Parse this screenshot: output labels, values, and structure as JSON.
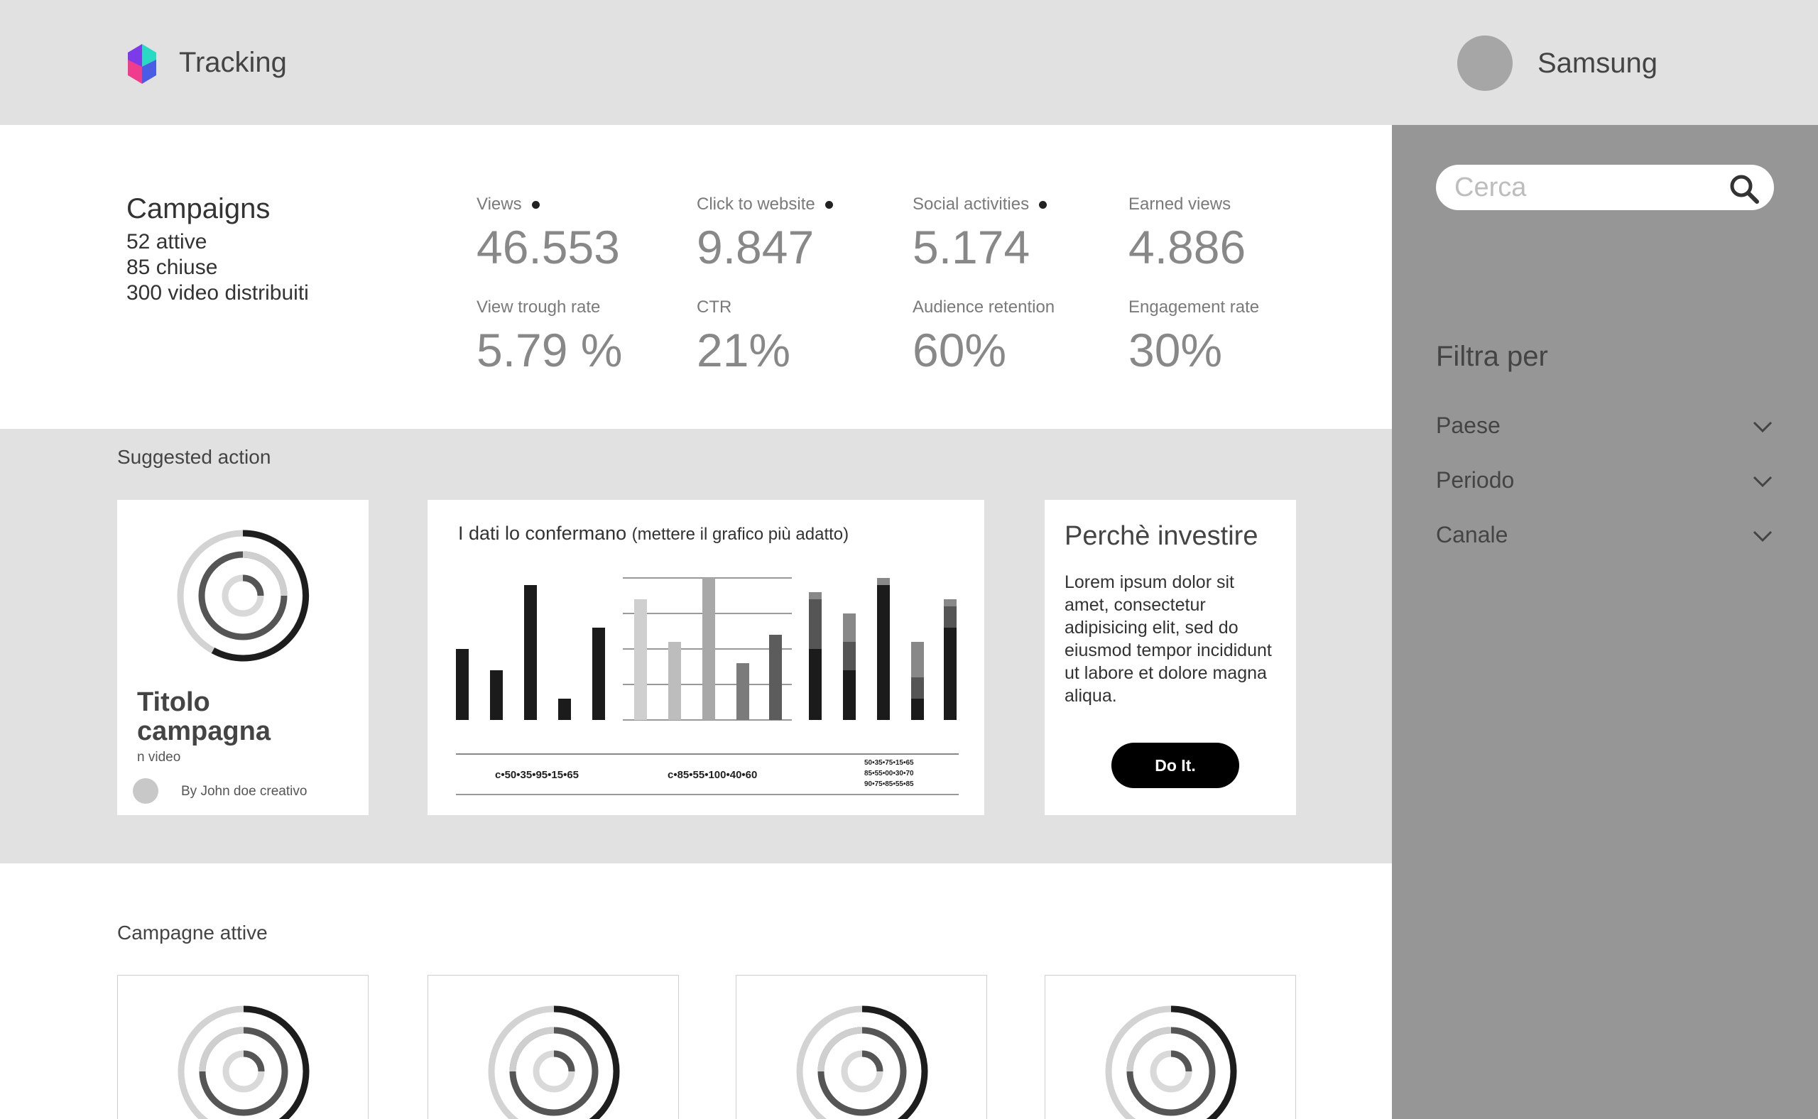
{
  "header": {
    "app_title": "Tracking",
    "user_name": "Samsung"
  },
  "search": {
    "placeholder": "Cerca"
  },
  "filters": {
    "title": "Filtra per",
    "items": [
      {
        "label": "Paese"
      },
      {
        "label": "Periodo"
      },
      {
        "label": "Canale"
      }
    ]
  },
  "campaigns": {
    "title": "Campaigns",
    "lines": [
      "52 attive",
      "85 chiuse",
      "300 video distribuiti"
    ]
  },
  "kpis": [
    {
      "label": "Views",
      "value": "46.553",
      "dot": true
    },
    {
      "label": "Click to website",
      "value": "9.847",
      "dot": true
    },
    {
      "label": "Social activities",
      "value": "5.174",
      "dot": true
    },
    {
      "label": "Earned views",
      "value": "4.886",
      "dot": false
    },
    {
      "label": "View trough rate",
      "value": "5.79 %",
      "dot": false
    },
    {
      "label": "CTR",
      "value": "21%",
      "dot": false
    },
    {
      "label": "Audience retention",
      "value": "60%",
      "dot": false
    },
    {
      "label": "Engagement rate",
      "value": "30%",
      "dot": false
    }
  ],
  "suggested": {
    "section_title": "Suggested action",
    "campaign_card": {
      "title": "Titolo campagna",
      "subtitle": "n video",
      "byline": "By John doe creativo"
    },
    "chart_card": {
      "title": "I dati lo confermano",
      "title_note": "(mettere il grafico più adatto)"
    },
    "invest_card": {
      "title": "Perchè investire",
      "body": "Lorem ipsum dolor sit amet, consectetur adipisicing elit, sed do eiusmod tempor incididunt ut labore et dolore magna aliqua.",
      "button_label": "Do It."
    }
  },
  "active_campaigns": {
    "section_title": "Campagne attive",
    "count": 4
  },
  "colors": {
    "header_bg": "#e1e1e1",
    "sidebar_bg": "#969696",
    "button_bg": "#000000"
  },
  "chart_data": [
    {
      "type": "bar",
      "categories": [
        "1",
        "2",
        "3",
        "4",
        "5"
      ],
      "values": [
        50,
        35,
        95,
        15,
        65
      ],
      "ylim": [
        0,
        100
      ],
      "legend_text": "c•50•35•95•15•65"
    },
    {
      "type": "bar",
      "categories": [
        "1",
        "2",
        "3",
        "4",
        "5"
      ],
      "values": [
        85,
        55,
        100,
        40,
        60
      ],
      "ylim": [
        0,
        100
      ],
      "grid": true,
      "legend_text": "c•85•55•100•40•60"
    },
    {
      "type": "bar",
      "stacked": true,
      "categories": [
        "1",
        "2",
        "3",
        "4",
        "5"
      ],
      "series": [
        {
          "values": [
            50,
            35,
            95,
            15,
            65
          ]
        },
        {
          "values": [
            35,
            20,
            0,
            15,
            15
          ]
        },
        {
          "values": [
            5,
            20,
            5,
            25,
            5
          ]
        }
      ],
      "ylim": [
        0,
        100
      ],
      "legend_text": [
        "50•35•75•15•65",
        "85•55•00•30•70",
        "90•75•85•55•85"
      ]
    }
  ]
}
